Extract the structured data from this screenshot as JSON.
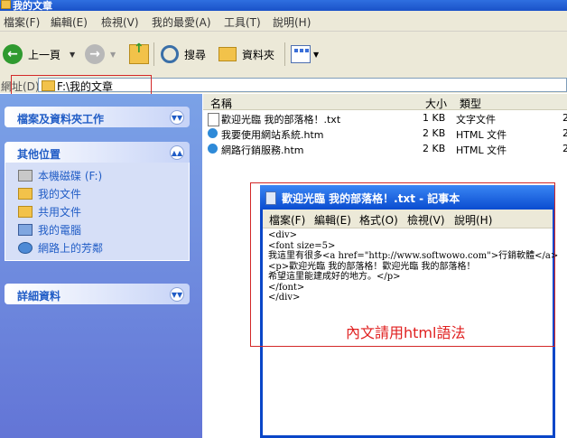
{
  "window": {
    "title": "我的文章"
  },
  "menubar": [
    "檔案(F)",
    "編輯(E)",
    "檢視(V)",
    "我的最愛(A)",
    "工具(T)",
    "說明(H)"
  ],
  "toolbar": {
    "back": "上一頁",
    "search": "搜尋",
    "folders": "資料夾"
  },
  "address": {
    "label": "網址(D)",
    "value": "F:\\我的文章"
  },
  "taskpane": {
    "file_tasks": "檔案及資料夾工作",
    "other_places": "其他位置",
    "places": [
      "本機磁碟 (F:)",
      "我的文件",
      "共用文件",
      "我的電腦",
      "網路上的芳鄰"
    ],
    "details": "詳細資料"
  },
  "columns": {
    "name": "名稱",
    "size": "大小",
    "type": "類型"
  },
  "files": [
    {
      "name": "歡迎光臨 我的部落格！.txt",
      "size": "1 KB",
      "type": "文字文件",
      "extra": "2"
    },
    {
      "name": "我要使用網站系統.htm",
      "size": "2 KB",
      "type": "HTML 文件",
      "extra": "2"
    },
    {
      "name": "網路行銷服務.htm",
      "size": "2 KB",
      "type": "HTML 文件",
      "extra": "2"
    }
  ],
  "notepad": {
    "title": "歡迎光臨 我的部落格！.txt - 記事本",
    "menu": [
      "檔案(F)",
      "編輯(E)",
      "格式(O)",
      "檢視(V)",
      "說明(H)"
    ],
    "content": "<div>\n<font size=5>\n我這里有很多<a href=\"http://www.softwowo.com\">行銷軟體</a>\n<p>歡迎光臨 我的部落格！歡迎光臨 我的部落格！\n希望這里能建成好的地方。</p>\n</font>\n</div>",
    "annotation": "內文請用html語法"
  },
  "colors": {
    "title_blue": "#1a52c8",
    "link_blue": "#215dc6",
    "highlight_red": "#d32828",
    "note_red": "#e02020"
  }
}
